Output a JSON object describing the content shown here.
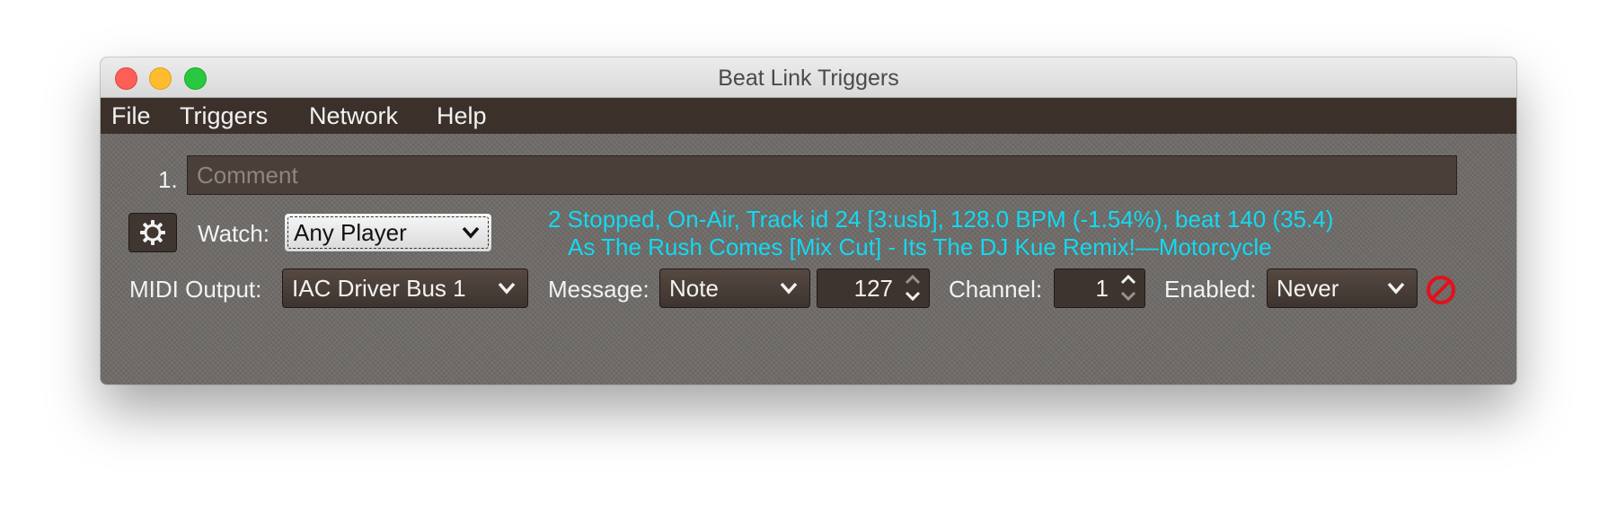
{
  "window": {
    "title": "Beat Link Triggers"
  },
  "menubar": {
    "items": [
      "File",
      "Triggers",
      "Network",
      "Help"
    ]
  },
  "trigger": {
    "index": "1.",
    "comment_placeholder": "Comment",
    "watch_label": "Watch:",
    "watch_value": "Any Player",
    "status_line1": "2 Stopped, On-Air, Track id 24 [3:usb], 128.0 BPM (-1.54%), beat 140 (35.4)",
    "status_line2": "As The Rush Comes [Mix Cut] - Its The DJ Kue Remix!—Motorcycle",
    "midi_output_label": "MIDI Output:",
    "midi_output_value": "IAC Driver Bus 1",
    "message_label": "Message:",
    "message_value": "Note",
    "note_value": "127",
    "channel_label": "Channel:",
    "channel_value": "1",
    "enabled_label": "Enabled:",
    "enabled_value": "Never"
  },
  "colors": {
    "status_text": "#12d9f2",
    "menubar_bg": "#3b302a",
    "disabled_icon": "#e3101c"
  },
  "icons": {
    "gear": "gear-icon",
    "disabled": "disabled-icon",
    "chevron": "chevron-down-icon"
  }
}
